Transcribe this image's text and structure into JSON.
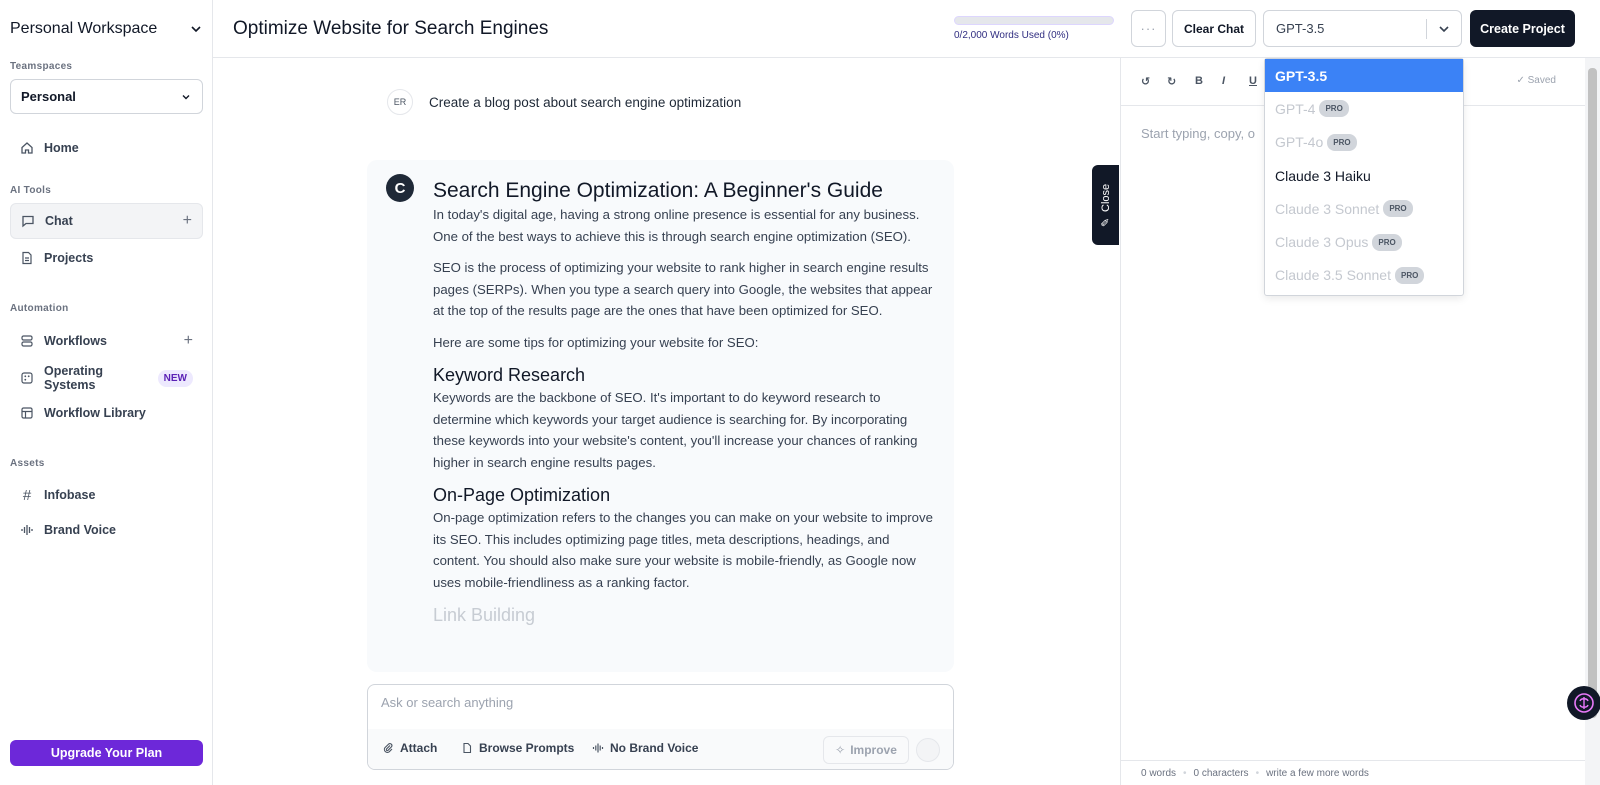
{
  "sidebar": {
    "workspace_title": "Personal Workspace",
    "teamspaces_label": "Teamspaces",
    "team_selected": "Personal",
    "home_label": "Home",
    "ai_tools_label": "AI Tools",
    "chat_label": "Chat",
    "projects_label": "Projects",
    "automation_label": "Automation",
    "workflows_label": "Workflows",
    "operating_systems_label": "Operating Systems",
    "new_badge": "NEW",
    "workflow_library_label": "Workflow Library",
    "assets_label": "Assets",
    "infobase_label": "Infobase",
    "brand_voice_label": "Brand Voice",
    "upgrade_label": "Upgrade Your Plan"
  },
  "header": {
    "title": "Optimize Website for Search Engines",
    "usage_text": "0/2,000 Words Used (0%)",
    "usage_fraction": 0,
    "more_label": "···",
    "clear_label": "Clear Chat",
    "model_value": "GPT-3.5",
    "create_label": "Create Project"
  },
  "chat": {
    "user_initials": "ER",
    "user_message": "Create a blog post about search engine optimization",
    "ai_logo": "C",
    "heading": "Search Engine Optimization: A Beginner's Guide",
    "p1": "In today's digital age, having a strong online presence is essential for any business. One of the best ways to achieve this is through search engine optimization (SEO).",
    "p2": "SEO is the process of optimizing your website to rank higher in search engine results pages (SERPs). When you type a search query into Google, the websites that appear at the top of the results page are the ones that have been optimized for SEO.",
    "p3": "Here are some tips for optimizing your website for SEO:",
    "h2_1": "Keyword Research",
    "p4": "Keywords are the backbone of SEO. It's important to do keyword research to determine which keywords your target audience is searching for. By incorporating these keywords into your website's content, you'll increase your chances of ranking higher in search engine results pages.",
    "h2_2": "On-Page Optimization",
    "p5": "On-page optimization refers to the changes you can make on your website to improve its SEO. This includes optimizing page titles, meta descriptions, headings, and content. You should also make sure your website is mobile-friendly, as Google now uses mobile-friendliness as a ranking factor.",
    "h2_3": "Link Building"
  },
  "composer": {
    "placeholder": "Ask or search anything",
    "attach_label": "Attach",
    "browse_label": "Browse Prompts",
    "brand_voice_label": "No Brand Voice",
    "improve_label": "Improve"
  },
  "close_tab_label": "Close",
  "editor": {
    "saved_label": "Saved",
    "placeholder": "Start typing, copy, o",
    "words": "0 words",
    "characters": "0 characters",
    "hint": "write a few more words"
  },
  "model_dropdown": {
    "options": [
      {
        "label": "GPT-3.5",
        "pro": false,
        "selected": true
      },
      {
        "label": "GPT-4",
        "pro": true
      },
      {
        "label": "GPT-4o",
        "pro": true
      },
      {
        "label": "Claude 3 Haiku",
        "pro": false
      },
      {
        "label": "Claude 3 Sonnet",
        "pro": true
      },
      {
        "label": "Claude 3 Opus",
        "pro": true
      },
      {
        "label": "Claude 3.5 Sonnet",
        "pro": true
      }
    ],
    "pro_badge": "PRO"
  },
  "colors": {
    "accent": "#6d28d9",
    "selected_option": "#3b82f6",
    "dark_button": "#111827"
  }
}
